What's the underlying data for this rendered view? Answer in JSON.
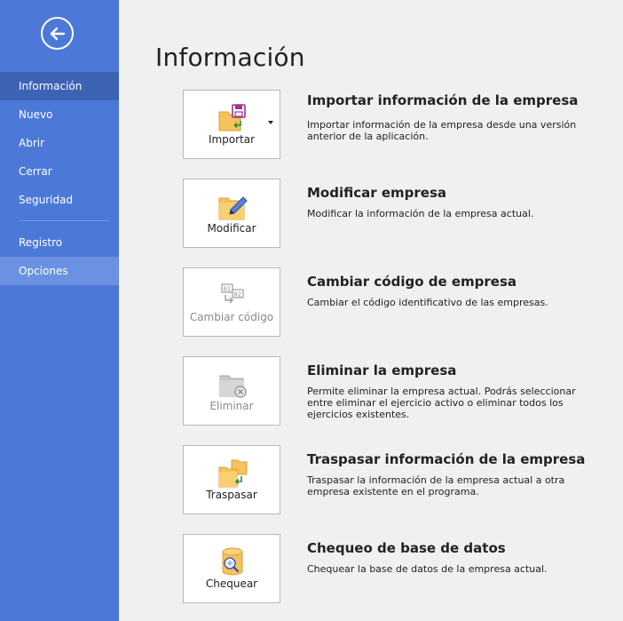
{
  "sidebar": {
    "back_icon": "back-arrow-icon",
    "items": [
      {
        "label": "Información",
        "state": "active"
      },
      {
        "label": "Nuevo"
      },
      {
        "label": "Abrir"
      },
      {
        "label": "Cerrar"
      },
      {
        "label": "Seguridad"
      },
      {
        "label": "Registro"
      },
      {
        "label": "Opciones",
        "state": "hover"
      }
    ]
  },
  "main": {
    "title": "Información",
    "actions": [
      {
        "button_label": "Importar",
        "icon": "import-folder-icon",
        "has_dropdown": true,
        "enabled": true,
        "title": "Importar información de la empresa",
        "description": "Importar información de la empresa desde una versión anterior de la aplicación."
      },
      {
        "button_label": "Modificar",
        "icon": "edit-folder-icon",
        "enabled": true,
        "title": "Modificar empresa",
        "description": "Modificar la información de la empresa actual."
      },
      {
        "button_label": "Cambiar código",
        "icon": "change-code-icon",
        "enabled": false,
        "title": "Cambiar código de empresa",
        "description": "Cambiar el código identificativo de las empresas."
      },
      {
        "button_label": "Eliminar",
        "icon": "delete-folder-icon",
        "enabled": false,
        "title": "Eliminar la empresa",
        "description": "Permite eliminar la empresa actual. Podrás seleccionar entre eliminar el ejercicio activo o eliminar todos los ejercicios existentes."
      },
      {
        "button_label": "Traspasar",
        "icon": "transfer-folder-icon",
        "enabled": true,
        "title": "Traspasar información de la empresa",
        "description": "Traspasar la información de la empresa actual a otra empresa existente en el programa."
      },
      {
        "button_label": "Chequear",
        "icon": "database-check-icon",
        "enabled": true,
        "title": "Chequeo de base de datos",
        "description": "Chequear la base de datos de la empresa actual."
      }
    ]
  },
  "colors": {
    "sidebar_bg": "#4c78d8",
    "sidebar_active": "#3d63b5",
    "sidebar_hover": "#6b92e2",
    "folder": "#f5c25c",
    "accent_purple": "#a0338c",
    "accent_green": "#2e8b2e"
  }
}
